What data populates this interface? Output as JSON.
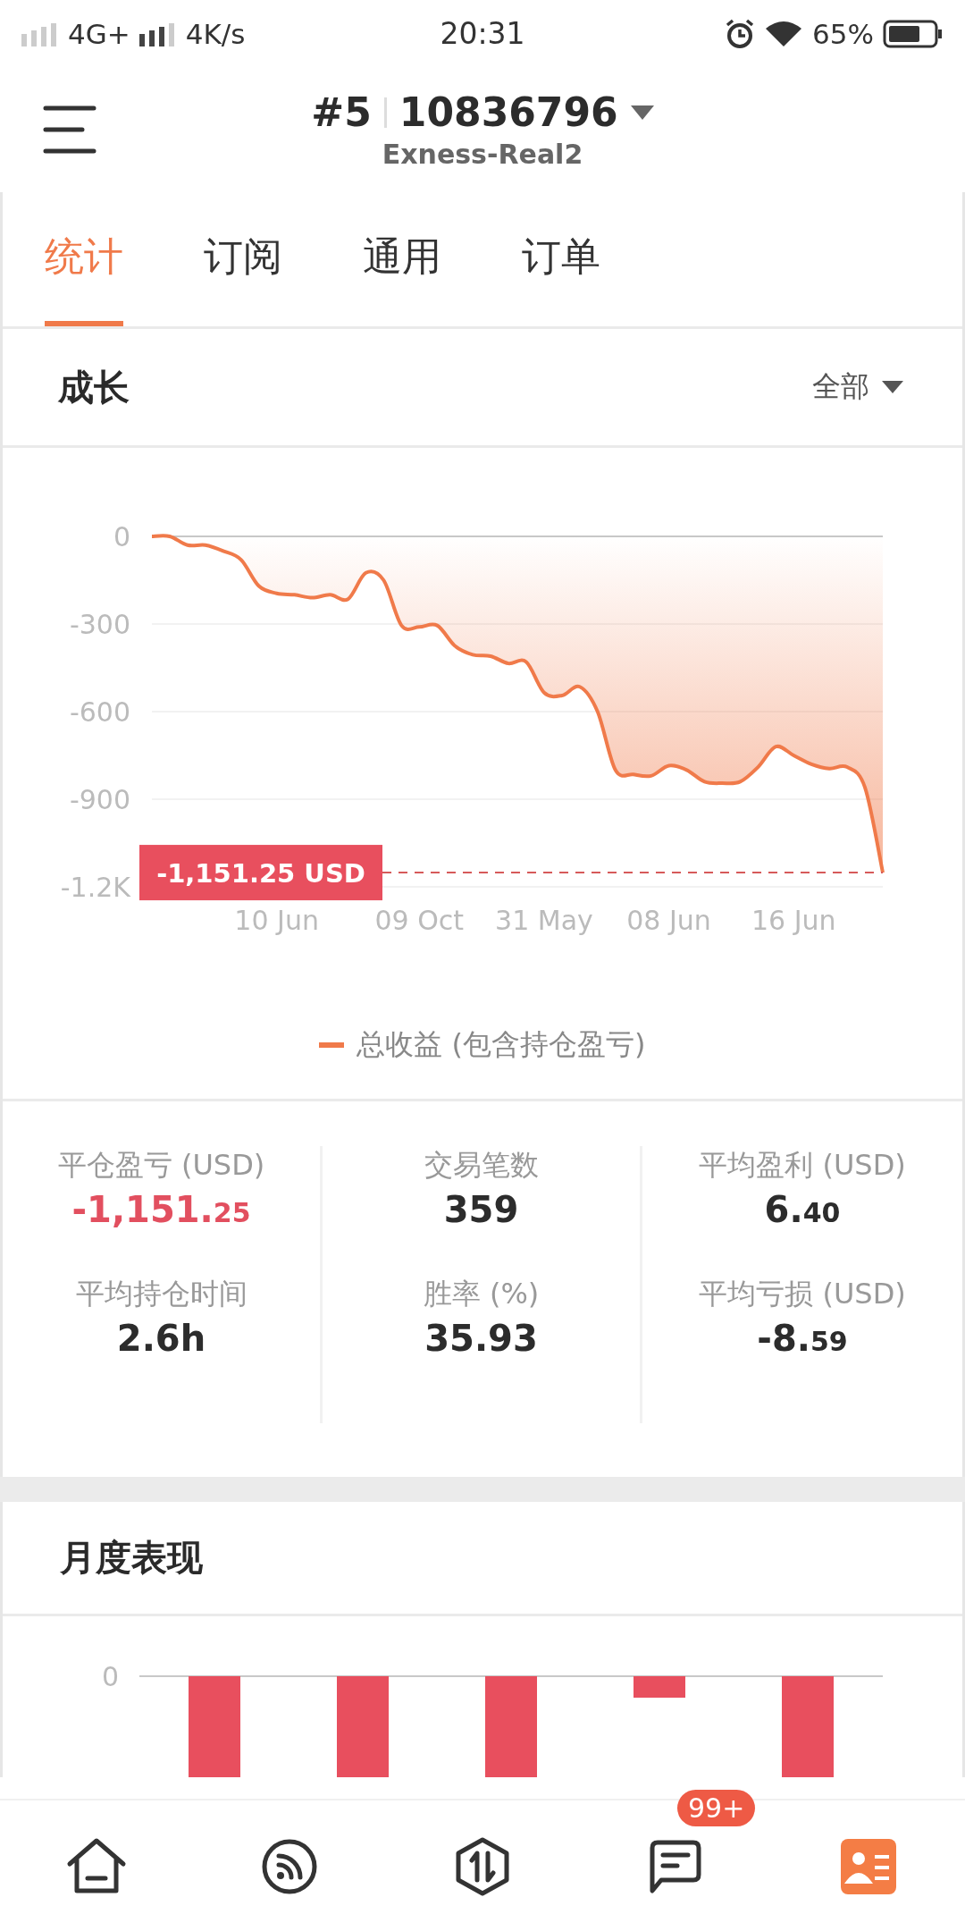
{
  "status_bar": {
    "network": "4G+",
    "speed": "4K/s",
    "time": "20:31",
    "battery": "65%"
  },
  "header": {
    "index": "#5",
    "account": "10836796",
    "server": "Exness-Real2"
  },
  "tabs": [
    {
      "label": "统计",
      "selected": true
    },
    {
      "label": "订阅",
      "selected": false
    },
    {
      "label": "通用",
      "selected": false
    },
    {
      "label": "订单",
      "selected": false
    }
  ],
  "growth": {
    "title": "成长",
    "filter": "全部",
    "marker_label": "-1,151.25 USD",
    "chart_data": {
      "type": "area",
      "ylim": [
        -1200,
        0
      ],
      "grid": true,
      "yticks": [
        0,
        -300,
        -600,
        -900,
        {
          "value": -1200,
          "label": "-1.2K"
        }
      ],
      "categories": [
        null,
        null,
        null,
        null,
        null,
        null,
        null,
        "10 Jun",
        null,
        null,
        null,
        null,
        null,
        null,
        null,
        "09 Oct",
        null,
        null,
        null,
        null,
        null,
        null,
        "31 May",
        null,
        null,
        null,
        null,
        null,
        null,
        "08 Jun",
        null,
        null,
        null,
        null,
        null,
        null,
        "16 Jun",
        null,
        null,
        null,
        null,
        null
      ],
      "series": [
        {
          "name": "总收益 (包含持仓盈亏)",
          "color": "#f07a4a",
          "values": [
            0,
            0,
            -30,
            -30,
            -50,
            -80,
            -170,
            -195,
            -200,
            -210,
            -200,
            -215,
            -125,
            -150,
            -305,
            -310,
            -305,
            -375,
            -405,
            -410,
            -435,
            -430,
            -535,
            -545,
            -515,
            -600,
            -800,
            -815,
            -820,
            -785,
            -800,
            -840,
            -845,
            -840,
            -790,
            -720,
            -750,
            -780,
            -795,
            -790,
            -860,
            -1151.25
          ]
        }
      ]
    }
  },
  "stats": [
    {
      "label": "平仓盈亏 (USD)",
      "value": "-1,151.",
      "fraction": "25",
      "emphasis": true
    },
    {
      "label": "交易笔数",
      "value": "359",
      "emphasis": false
    },
    {
      "label": "平均盈利 (USD)",
      "value": "6.",
      "fraction": "40",
      "emphasis": false
    },
    {
      "label": "平均持仓时间",
      "value": "2.6h",
      "emphasis": false
    },
    {
      "label": "胜率 (%)",
      "value": "35.93",
      "emphasis": false
    },
    {
      "label": "平均亏损 (USD)",
      "value": "-8.",
      "fraction": "59",
      "emphasis": false
    }
  ],
  "monthly": {
    "title": "月度表现",
    "zero_label": "0"
  },
  "nav": [
    {
      "kind": "home",
      "selected": false
    },
    {
      "kind": "feed",
      "selected": false
    },
    {
      "kind": "trade",
      "selected": false
    },
    {
      "kind": "messages",
      "selected": false,
      "badge": "99+"
    },
    {
      "kind": "profile",
      "selected": true
    }
  ]
}
